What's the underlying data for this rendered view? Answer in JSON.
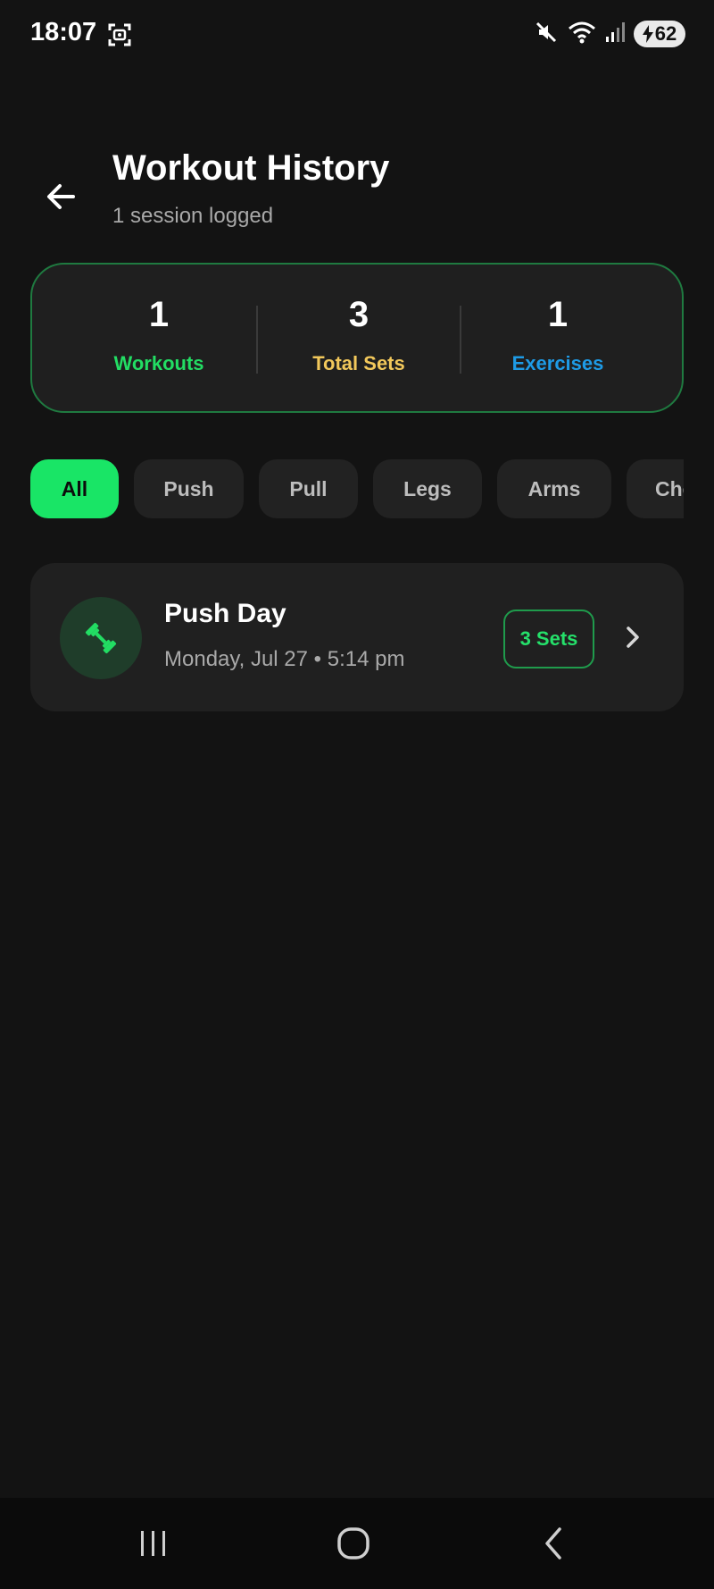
{
  "status_bar": {
    "time": "18:07",
    "battery": "62",
    "icons": [
      "screenshot-icon",
      "mute-icon",
      "wifi-icon",
      "signal-icon",
      "charging-icon"
    ]
  },
  "header": {
    "title": "Workout History",
    "subtitle": "1 session logged",
    "back_icon": "arrow-left-icon"
  },
  "stats": [
    {
      "value": "1",
      "label": "Workouts",
      "color": "#22dd63"
    },
    {
      "value": "3",
      "label": "Total Sets",
      "color": "#f2c85b"
    },
    {
      "value": "1",
      "label": "Exercises",
      "color": "#1e9be6"
    }
  ],
  "filters": {
    "active": "All",
    "chips": [
      "All",
      "Push",
      "Pull",
      "Legs",
      "Arms",
      "Che"
    ]
  },
  "workouts": [
    {
      "title": "Push Day",
      "meta": "Monday, Jul 27 • 5:14 pm",
      "sets_badge": "3 Sets",
      "icon": "dumbbell-icon"
    }
  ],
  "colors": {
    "background": "#131313",
    "card": "#202020",
    "accent": "#19e566",
    "card_border": "#1f7a40"
  },
  "nav": {
    "icons": [
      "recent-apps-icon",
      "home-icon",
      "back-icon"
    ]
  }
}
